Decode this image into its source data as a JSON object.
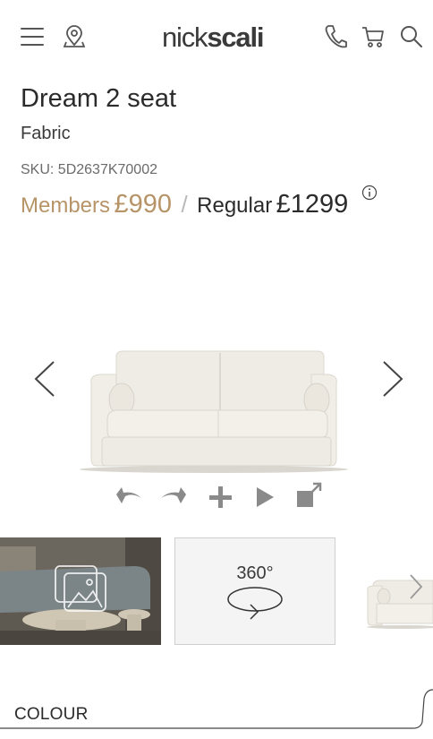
{
  "brand": {
    "light": "nick",
    "bold": "scali"
  },
  "header": {
    "menu_icon": "hamburger-menu-icon",
    "store_icon": "location-pin-icon",
    "phone_icon": "phone-icon",
    "cart_icon": "cart-icon",
    "search_icon": "search-icon"
  },
  "product": {
    "title": "Dream 2 seat",
    "subtitle": "Fabric",
    "sku": "SKU: 5D2637K70002",
    "members_label": "Members",
    "members_price": "£990",
    "separator": "/",
    "regular_label": "Regular",
    "regular_price": "£1299"
  },
  "gallery": {
    "controls": [
      "rotate-left-icon",
      "rotate-right-icon",
      "zoom-plus-icon",
      "play-icon",
      "expand-icon"
    ],
    "thumbnail_360_label": "360°"
  },
  "colour_section": {
    "label": "COLOUR"
  },
  "colors": {
    "accent": "#b79467",
    "text": "#2b2b2b",
    "icon": "#555555"
  }
}
